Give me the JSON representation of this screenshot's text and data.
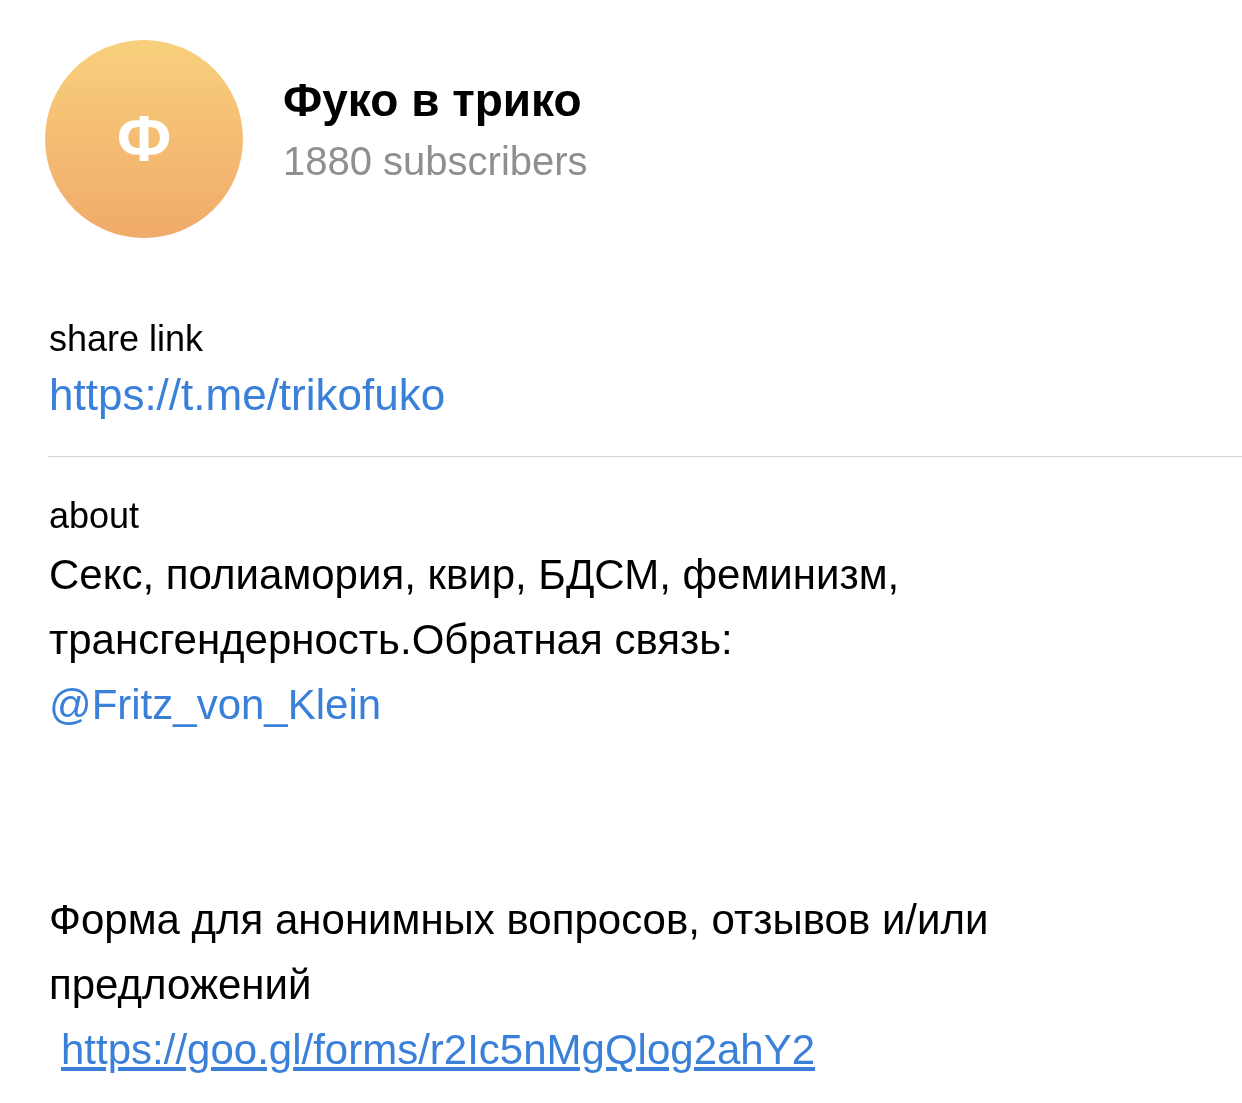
{
  "channel": {
    "avatar_letter": "Ф",
    "title": "Фуко в трико",
    "subscribers": "1880 subscribers"
  },
  "share": {
    "label": "share link",
    "link": "https://t.me/trikofuko"
  },
  "about": {
    "label": "about",
    "paragraphs": [
      {
        "text": "Секс, полиамория, квир, БДСМ, феминизм, трансгендерность.Обратная связь:",
        "link": "@Fritz_von_Klein",
        "underlined": false
      },
      {
        "text": "Форма для анонимных вопросов, отзывов и/или предложений",
        "link": "https://goo.gl/forms/r2Ic5nMgQlog2ahY2",
        "underlined": true
      }
    ]
  }
}
